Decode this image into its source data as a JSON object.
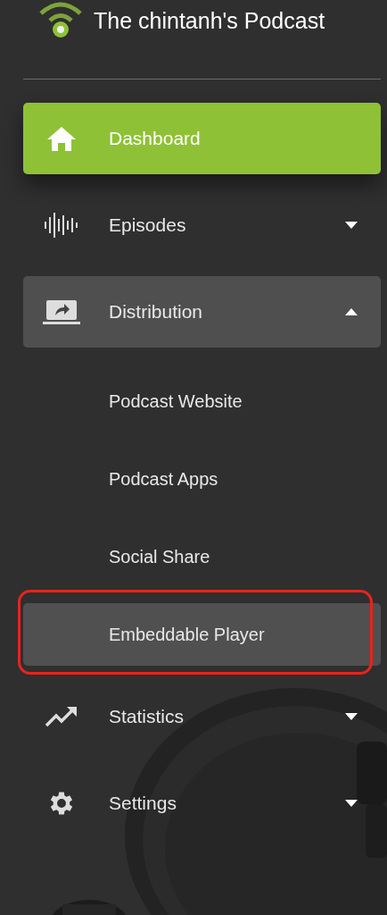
{
  "header": {
    "title": "The chintanh's Podcast"
  },
  "nav": [
    {
      "label": "Dashboard",
      "kind": "link",
      "selected": true
    },
    {
      "label": "Episodes",
      "kind": "group",
      "selected": false,
      "expanded": false
    },
    {
      "label": "Distribution",
      "kind": "group",
      "selected": false,
      "expanded": true,
      "children": [
        {
          "label": "Podcast Website",
          "selected": false,
          "highlighted": false
        },
        {
          "label": "Podcast Apps",
          "selected": false,
          "highlighted": false
        },
        {
          "label": "Social Share",
          "selected": false,
          "highlighted": false
        },
        {
          "label": "Embeddable Player",
          "selected": true,
          "highlighted": true
        }
      ]
    },
    {
      "label": "Statistics",
      "kind": "group",
      "selected": false,
      "expanded": false
    },
    {
      "label": "Settings",
      "kind": "group",
      "selected": false,
      "expanded": false
    }
  ]
}
